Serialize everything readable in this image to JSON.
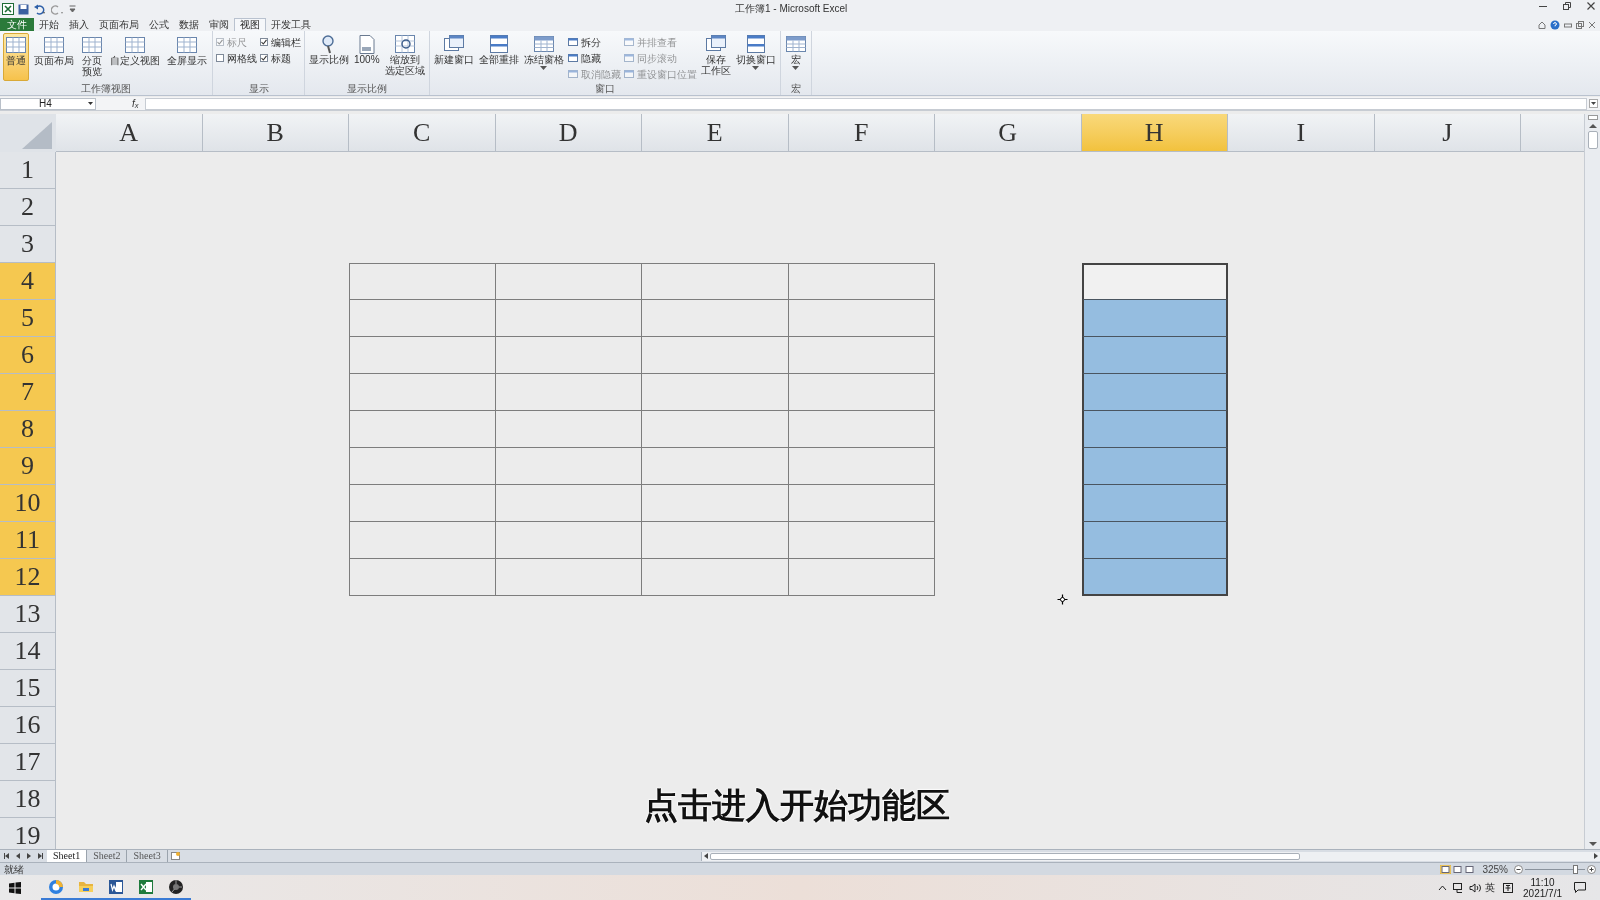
{
  "window": {
    "title": "工作簿1 - Microsoft Excel"
  },
  "ribbon_tabs": [
    {
      "label": "文件",
      "kind": "file",
      "selected": false
    },
    {
      "label": "开始",
      "kind": "tab",
      "selected": false
    },
    {
      "label": "插入",
      "kind": "tab",
      "selected": false
    },
    {
      "label": "页面布局",
      "kind": "tab",
      "selected": false
    },
    {
      "label": "公式",
      "kind": "tab",
      "selected": false
    },
    {
      "label": "数据",
      "kind": "tab",
      "selected": false
    },
    {
      "label": "审阅",
      "kind": "tab",
      "selected": false
    },
    {
      "label": "视图",
      "kind": "tab",
      "selected": true
    },
    {
      "label": "开发工具",
      "kind": "tab",
      "selected": false
    }
  ],
  "ribbon_groups": [
    {
      "title": "工作簿视图",
      "items": [
        {
          "kind": "view",
          "lines": [
            "普通"
          ],
          "selected": true
        },
        {
          "kind": "view",
          "lines": [
            "页面布局"
          ],
          "selected": false
        },
        {
          "kind": "view",
          "lines": [
            "分页",
            "预览"
          ],
          "selected": false
        },
        {
          "kind": "view",
          "lines": [
            "自定义视图"
          ],
          "selected": false
        },
        {
          "kind": "view",
          "lines": [
            "全屏显示"
          ],
          "selected": false
        }
      ]
    },
    {
      "title": "显示",
      "items": [
        {
          "kind": "checkbox",
          "label": "标尺",
          "checked": true,
          "disabled": true
        },
        {
          "kind": "checkbox",
          "label": "网格线",
          "checked": false,
          "disabled": false
        },
        {
          "kind": "checkbox",
          "label": "编辑栏",
          "checked": true,
          "disabled": false
        },
        {
          "kind": "checkbox",
          "label": "标题",
          "checked": true,
          "disabled": false
        }
      ]
    },
    {
      "title": "显示比例",
      "items": [
        {
          "kind": "large",
          "lines": [
            "显示比例"
          ]
        },
        {
          "kind": "large",
          "lines": [
            "100%"
          ]
        },
        {
          "kind": "large",
          "lines": [
            "缩放到",
            "选定区域"
          ]
        }
      ]
    },
    {
      "title": "窗口",
      "items": [
        {
          "kind": "large",
          "lines": [
            "新建窗口"
          ]
        },
        {
          "kind": "large",
          "lines": [
            "全部重排"
          ]
        },
        {
          "kind": "large",
          "lines": [
            "冻结窗格"
          ],
          "dropdown": true
        },
        {
          "kind": "small",
          "label": "拆分",
          "disabled": false
        },
        {
          "kind": "small",
          "label": "隐藏",
          "disabled": false
        },
        {
          "kind": "small",
          "label": "取消隐藏",
          "disabled": true
        },
        {
          "kind": "small",
          "label": "并排查看",
          "disabled": true
        },
        {
          "kind": "small",
          "label": "同步滚动",
          "disabled": true
        },
        {
          "kind": "small",
          "label": "重设窗口位置",
          "disabled": true
        },
        {
          "kind": "large",
          "lines": [
            "保存",
            "工作区"
          ]
        },
        {
          "kind": "large",
          "lines": [
            "切换窗口"
          ],
          "dropdown": true
        }
      ]
    },
    {
      "title": "宏",
      "items": [
        {
          "kind": "large",
          "lines": [
            "宏"
          ],
          "dropdown": true
        }
      ]
    }
  ],
  "name_box": {
    "value": "H4"
  },
  "formula_bar": {
    "function_label": "f$_{x}$"
  },
  "sheet": {
    "columns": [
      {
        "label": "A",
        "selected": false,
        "in_table": false
      },
      {
        "label": "B",
        "selected": false,
        "in_table": false
      },
      {
        "label": "C",
        "selected": false,
        "in_table": true
      },
      {
        "label": "D",
        "selected": false,
        "in_table": true
      },
      {
        "label": "E",
        "selected": false,
        "in_table": true
      },
      {
        "label": "F",
        "selected": false,
        "in_table": true
      },
      {
        "label": "G",
        "selected": false,
        "in_table": false
      },
      {
        "label": "H",
        "selected": true,
        "in_table": false
      },
      {
        "label": "I",
        "selected": false,
        "in_table": false
      },
      {
        "label": "J",
        "selected": false,
        "in_table": false
      }
    ],
    "rows": [
      {
        "label": "1",
        "selected": false,
        "in_table": false
      },
      {
        "label": "2",
        "selected": false,
        "in_table": false
      },
      {
        "label": "3",
        "selected": false,
        "in_table": false
      },
      {
        "label": "4",
        "selected": true,
        "in_table": true
      },
      {
        "label": "5",
        "selected": true,
        "in_table": true
      },
      {
        "label": "6",
        "selected": true,
        "in_table": true
      },
      {
        "label": "7",
        "selected": true,
        "in_table": true
      },
      {
        "label": "8",
        "selected": true,
        "in_table": true
      },
      {
        "label": "9",
        "selected": true,
        "in_table": true
      },
      {
        "label": "10",
        "selected": true,
        "in_table": true
      },
      {
        "label": "11",
        "selected": true,
        "in_table": true
      },
      {
        "label": "12",
        "selected": true,
        "in_table": true
      },
      {
        "label": "13",
        "selected": false,
        "in_table": false
      },
      {
        "label": "14",
        "selected": false,
        "in_table": false
      },
      {
        "label": "15",
        "selected": false,
        "in_table": false
      },
      {
        "label": "16",
        "selected": false,
        "in_table": false
      },
      {
        "label": "17",
        "selected": false,
        "in_table": false
      },
      {
        "label": "18",
        "selected": false,
        "in_table": false
      },
      {
        "label": "19",
        "selected": false,
        "in_table": false
      }
    ]
  },
  "caption": "点击进入开始功能区",
  "sheet_tabs": [
    {
      "label": "Sheet1",
      "selected": true
    },
    {
      "label": "Sheet2",
      "selected": false
    },
    {
      "label": "Sheet3",
      "selected": false
    }
  ],
  "status_bar": {
    "text": "就绪",
    "views": [
      {
        "selected": true
      },
      {
        "selected": false
      },
      {
        "selected": false
      }
    ],
    "zoom": "325%",
    "zoom_slider": {
      "level": 0.88
    }
  },
  "taskbar": {
    "input_language": "英",
    "time": "11:10",
    "date": "2021/7/1"
  }
}
